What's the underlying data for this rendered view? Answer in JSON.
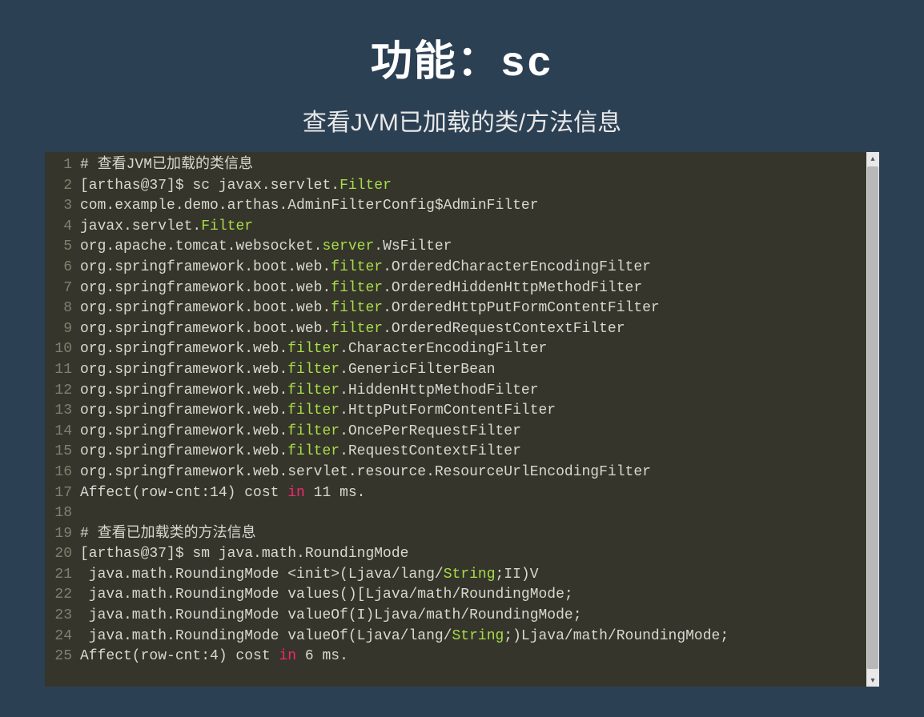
{
  "title_prefix": "功能：",
  "title_cmd": "sc",
  "subtitle": "查看JVM已加载的类/方法信息",
  "code_lines": [
    [
      {
        "t": "# 查看JVM已加载的类信息"
      }
    ],
    [
      {
        "t": "[arthas@37]$ sc javax.servlet."
      },
      {
        "t": "Filter",
        "c": "str"
      }
    ],
    [
      {
        "t": "com.example.demo.arthas.AdminFilterConfig$AdminFilter"
      }
    ],
    [
      {
        "t": "javax.servlet."
      },
      {
        "t": "Filter",
        "c": "str"
      }
    ],
    [
      {
        "t": "org.apache.tomcat.websocket."
      },
      {
        "t": "server",
        "c": "str"
      },
      {
        "t": ".WsFilter"
      }
    ],
    [
      {
        "t": "org.springframework.boot.web."
      },
      {
        "t": "filter",
        "c": "str"
      },
      {
        "t": ".OrderedCharacterEncodingFilter"
      }
    ],
    [
      {
        "t": "org.springframework.boot.web."
      },
      {
        "t": "filter",
        "c": "str"
      },
      {
        "t": ".OrderedHiddenHttpMethodFilter"
      }
    ],
    [
      {
        "t": "org.springframework.boot.web."
      },
      {
        "t": "filter",
        "c": "str"
      },
      {
        "t": ".OrderedHttpPutFormContentFilter"
      }
    ],
    [
      {
        "t": "org.springframework.boot.web."
      },
      {
        "t": "filter",
        "c": "str"
      },
      {
        "t": ".OrderedRequestContextFilter"
      }
    ],
    [
      {
        "t": "org.springframework.web."
      },
      {
        "t": "filter",
        "c": "str"
      },
      {
        "t": ".CharacterEncodingFilter"
      }
    ],
    [
      {
        "t": "org.springframework.web."
      },
      {
        "t": "filter",
        "c": "str"
      },
      {
        "t": ".GenericFilterBean"
      }
    ],
    [
      {
        "t": "org.springframework.web."
      },
      {
        "t": "filter",
        "c": "str"
      },
      {
        "t": ".HiddenHttpMethodFilter"
      }
    ],
    [
      {
        "t": "org.springframework.web."
      },
      {
        "t": "filter",
        "c": "str"
      },
      {
        "t": ".HttpPutFormContentFilter"
      }
    ],
    [
      {
        "t": "org.springframework.web."
      },
      {
        "t": "filter",
        "c": "str"
      },
      {
        "t": ".OncePerRequestFilter"
      }
    ],
    [
      {
        "t": "org.springframework.web."
      },
      {
        "t": "filter",
        "c": "str"
      },
      {
        "t": ".RequestContextFilter"
      }
    ],
    [
      {
        "t": "org.springframework.web.servlet.resource.ResourceUrlEncodingFilter"
      }
    ],
    [
      {
        "t": "Affect(row-cnt:14) cost "
      },
      {
        "t": "in",
        "c": "kw"
      },
      {
        "t": " 11 ms."
      }
    ],
    [
      {
        "t": ""
      }
    ],
    [
      {
        "t": "# 查看已加载类的方法信息"
      }
    ],
    [
      {
        "t": "[arthas@37]$ sm java.math.RoundingMode"
      }
    ],
    [
      {
        "t": " java.math.RoundingMode <init>(Ljava/lang/"
      },
      {
        "t": "String",
        "c": "str"
      },
      {
        "t": ";II)V"
      }
    ],
    [
      {
        "t": " java.math.RoundingMode values()[Ljava/math/RoundingMode;"
      }
    ],
    [
      {
        "t": " java.math.RoundingMode valueOf(I)Ljava/math/RoundingMode;"
      }
    ],
    [
      {
        "t": " java.math.RoundingMode valueOf(Ljava/lang/"
      },
      {
        "t": "String",
        "c": "str"
      },
      {
        "t": ";)Ljava/math/RoundingMode;"
      }
    ],
    [
      {
        "t": "Affect(row-cnt:4) cost "
      },
      {
        "t": "in",
        "c": "kw"
      },
      {
        "t": " 6 ms."
      }
    ]
  ]
}
